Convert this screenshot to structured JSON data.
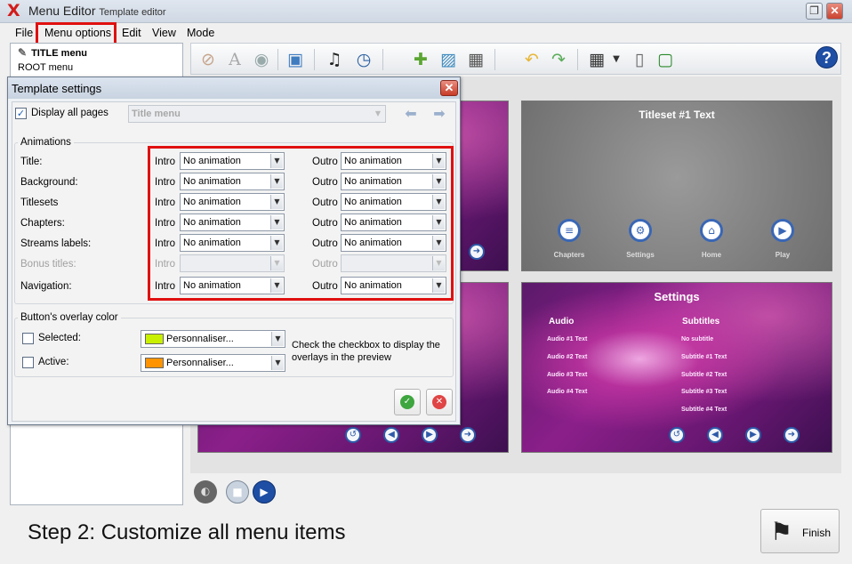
{
  "window": {
    "title": "Menu Editor",
    "subtitle": "Template editor",
    "logo_glyph": "X",
    "maximize_glyph": "❐",
    "close_glyph": "✕"
  },
  "menubar": [
    "File",
    "Menu options",
    "Edit",
    "View",
    "Mode"
  ],
  "tree": {
    "items": [
      "TITLE menu",
      "ROOT menu"
    ]
  },
  "toolbar": {
    "icons": [
      "brush-icon",
      "text-icon",
      "eye-icon",
      "background-settings-icon",
      "audio-icon",
      "timer-icon",
      "add-text-icon",
      "add-image-icon",
      "add-video-icon",
      "undo-icon",
      "redo-icon",
      "grid-icon",
      "remote-icon",
      "safe-area-icon"
    ],
    "help_glyph": "?"
  },
  "preview": {
    "titleset_title": "Titleset #1 Text",
    "titleset_buttons": [
      "Chapters",
      "Settings",
      "Home",
      "Play"
    ],
    "settings_title": "Settings",
    "settings_columns": [
      "Audio",
      "Subtitles"
    ],
    "audio_items": [
      "Audio #1 Text",
      "Audio #2 Text",
      "Audio #3 Text",
      "Audio #4 Text"
    ],
    "subtitle_items": [
      "No subtitle",
      "Subtitle #1 Text",
      "Subtitle #2 Text",
      "Subtitle #3 Text",
      "Subtitle #4 Text"
    ]
  },
  "dialog": {
    "title": "Template settings",
    "close_glyph": "✕",
    "display_all_pages": {
      "label": "Display all pages",
      "checked": true,
      "check_glyph": "✓"
    },
    "page_select": "Title menu",
    "animations": {
      "group_label": "Animations",
      "intro_label": "Intro",
      "outro_label": "Outro",
      "rows": [
        {
          "label": "Title:",
          "intro": "No animation",
          "outro": "No animation",
          "enabled": true
        },
        {
          "label": "Background:",
          "intro": "No animation",
          "outro": "No animation",
          "enabled": true
        },
        {
          "label": "Titlesets",
          "intro": "No animation",
          "outro": "No animation",
          "enabled": true
        },
        {
          "label": "Chapters:",
          "intro": "No animation",
          "outro": "No animation",
          "enabled": true
        },
        {
          "label": "Streams labels:",
          "intro": "No animation",
          "outro": "No animation",
          "enabled": true
        },
        {
          "label": "Bonus titles:",
          "intro": "",
          "outro": "",
          "enabled": false
        },
        {
          "label": "Navigation:",
          "intro": "No animation",
          "outro": "No animation",
          "enabled": true
        }
      ]
    },
    "overlay": {
      "group_label": "Button's overlay color",
      "selected": {
        "label": "Selected:",
        "color": "#c8f000",
        "value": "Personnaliser..."
      },
      "active": {
        "label": "Active:",
        "color": "#ff9400",
        "value": "Personnaliser..."
      },
      "hint": "Check the checkbox to display the overlays in the preview"
    },
    "ok_glyph": "✓",
    "cancel_glyph": "✕"
  },
  "footer": {
    "step_text": "Step 2: Customize all menu items",
    "finish_label": "Finish"
  },
  "colors": {
    "highlight": "#e01010",
    "accent_blue": "#1e4fa5"
  }
}
